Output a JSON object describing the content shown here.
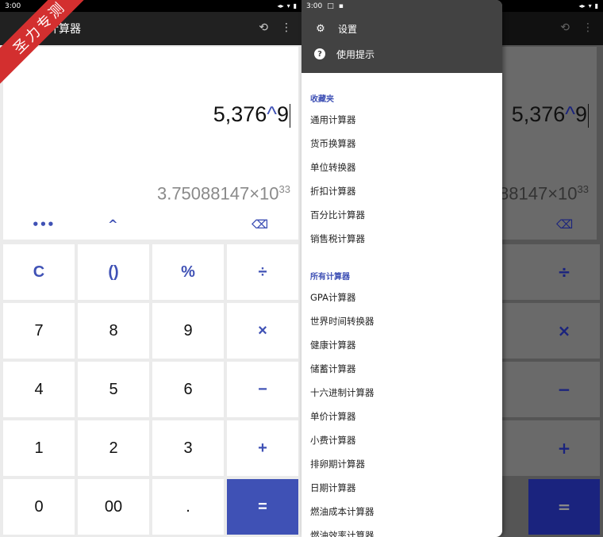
{
  "status": {
    "time": "3:00",
    "drawer_time": "3:00"
  },
  "app": {
    "title": "计算器"
  },
  "watermark": {
    "text": "圣力专测"
  },
  "display": {
    "expression_base": "5,376",
    "expression_op": "^",
    "expression_exp": "9",
    "result_mantissa": "3.75088147×10",
    "result_exponent": "33",
    "right_result_mantissa": "88147×10",
    "right_result_exponent": "33"
  },
  "function_row": {
    "more": "•••",
    "power": "^",
    "backspace": "⌫"
  },
  "keypad": {
    "row1": [
      "C",
      "()",
      "%",
      "÷"
    ],
    "row2": [
      "7",
      "8",
      "9",
      "×"
    ],
    "row3": [
      "4",
      "5",
      "6",
      "−"
    ],
    "row4": [
      "1",
      "2",
      "3",
      "+"
    ],
    "row5": [
      "0",
      "00",
      ".",
      "="
    ]
  },
  "drawer": {
    "settings": "设置",
    "tips": "使用提示",
    "favorites_header": "收藏夹",
    "favorites": [
      "通用计算器",
      "货币换算器",
      "单位转换器",
      "折扣计算器",
      "百分比计算器",
      "销售税计算器"
    ],
    "all_header": "所有计算器",
    "all": [
      "GPA计算器",
      "世界时间转换器",
      "健康计算器",
      "储蓄计算器",
      "十六进制计算器",
      "单价计算器",
      "小费计算器",
      "排卵期计算器",
      "日期计算器",
      "燃油成本计算器",
      "燃油效率计算器"
    ]
  },
  "colors": {
    "accent": "#3f51b5",
    "appbar": "#212121",
    "drawer_header": "#424242",
    "watermark": "#d32f2f"
  }
}
